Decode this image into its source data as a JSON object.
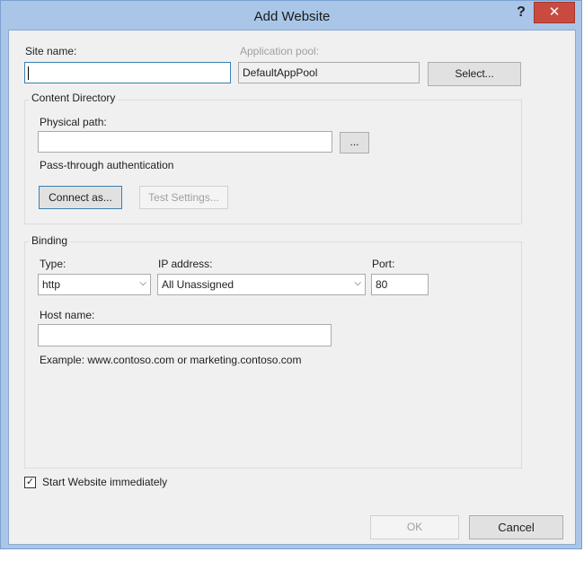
{
  "window": {
    "title": "Add Website",
    "help_label": "?",
    "close_label": "✕"
  },
  "site": {
    "site_name_label": "Site name:",
    "site_name_value": "",
    "app_pool_label": "Application pool:",
    "app_pool_value": "DefaultAppPool",
    "select_label": "Select..."
  },
  "content_directory": {
    "group_title": "Content Directory",
    "physical_path_label": "Physical path:",
    "physical_path_value": "",
    "browse_label": "...",
    "pass_through_label": "Pass-through authentication",
    "connect_as_label": "Connect as...",
    "test_settings_label": "Test Settings..."
  },
  "binding": {
    "group_title": "Binding",
    "type_label": "Type:",
    "type_value": "http",
    "ip_label": "IP address:",
    "ip_value": "All Unassigned",
    "port_label": "Port:",
    "port_value": "80",
    "host_name_label": "Host name:",
    "host_name_value": "",
    "example_text": "Example: www.contoso.com or marketing.contoso.com"
  },
  "options": {
    "start_immediately_label": "Start Website immediately",
    "start_immediately_checked": true
  },
  "footer": {
    "ok_label": "OK",
    "cancel_label": "Cancel"
  },
  "colors": {
    "frame": "#a9c6e8",
    "close_button": "#c94b40",
    "dialog_background": "#f0f0f0"
  }
}
